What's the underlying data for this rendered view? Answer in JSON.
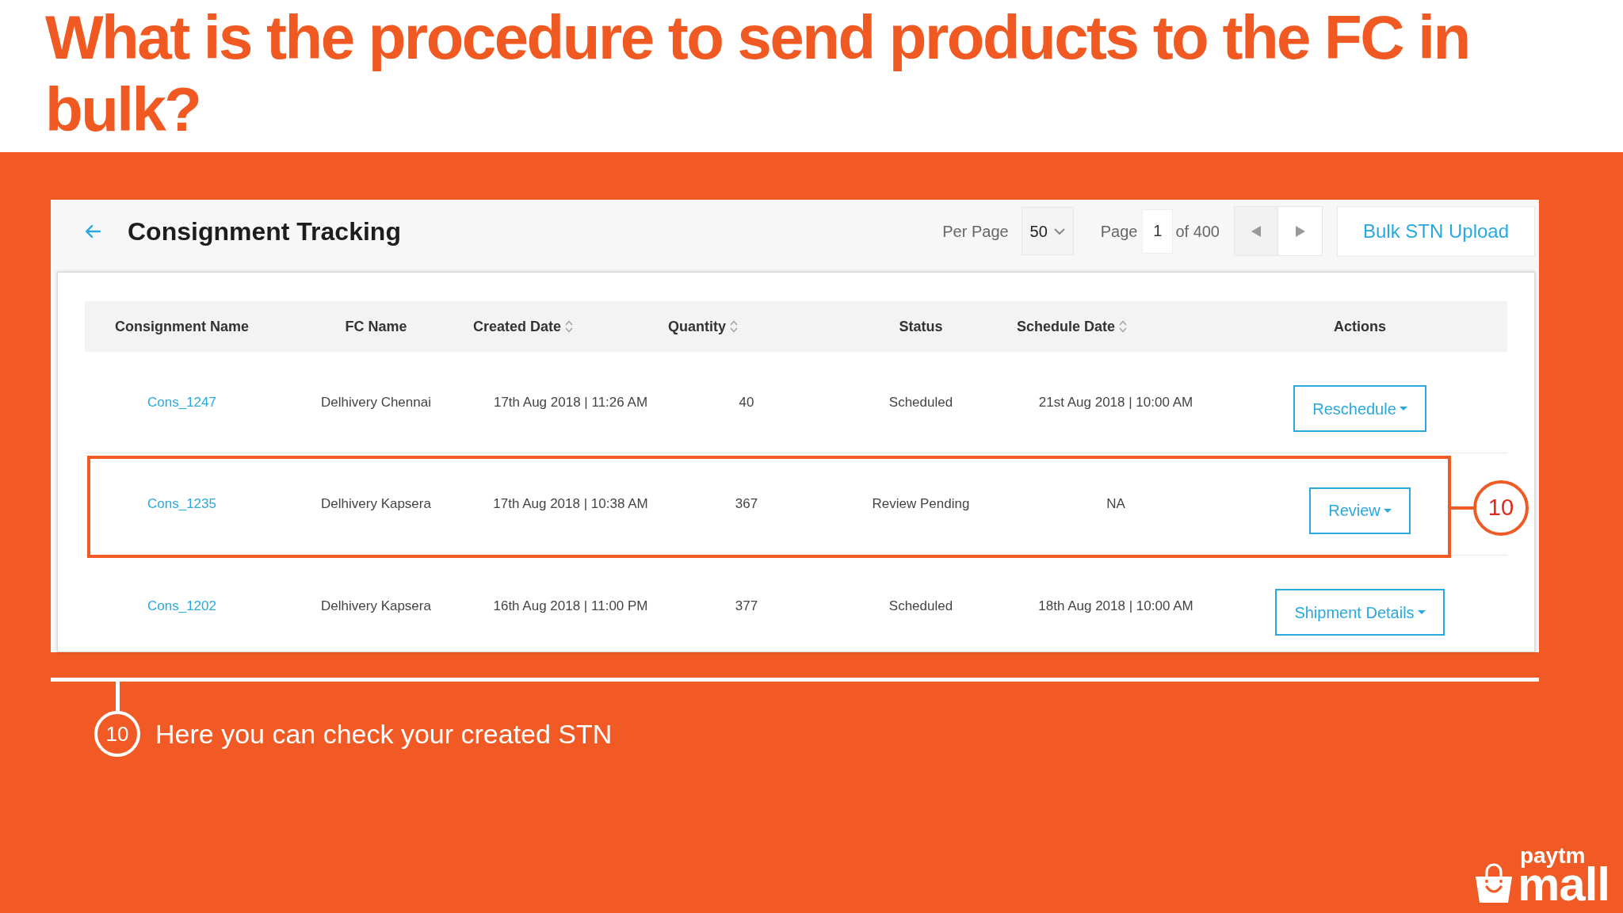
{
  "slide": {
    "title": "What is the procedure to send products to the FC in bulk?"
  },
  "panel": {
    "title": "Consignment Tracking",
    "pagination": {
      "per_page_label": "Per Page",
      "per_page": "50",
      "page_label": "Page",
      "page": "1",
      "page_total": "of 400",
      "prev": {
        "disabled": true
      },
      "next": {
        "disabled": false
      }
    },
    "upload_button": "Bulk STN Upload"
  },
  "table": {
    "columns": [
      {
        "label": "Consignment Name",
        "kind": "link",
        "sortable": false
      },
      {
        "label": "FC Name",
        "kind": "text",
        "sortable": false
      },
      {
        "label": "Created Date",
        "kind": "text",
        "sortable": true
      },
      {
        "label": "Quantity",
        "kind": "text",
        "sortable": true
      },
      {
        "label": "Status",
        "kind": "text",
        "sortable": false
      },
      {
        "label": "Schedule Date",
        "kind": "text",
        "sortable": true
      },
      {
        "label": "Actions",
        "kind": "action",
        "sortable": false
      }
    ],
    "rows": [
      {
        "highlighted": false,
        "cells": [
          "Cons_1247",
          "Delhivery Chennai",
          "17th Aug 2018 | 11:26 AM",
          "40",
          "Scheduled",
          "21st Aug 2018 | 10:00 AM",
          "Reschedule"
        ]
      },
      {
        "highlighted": true,
        "marker": "10",
        "cells": [
          "Cons_1235",
          "Delhivery Kapsera",
          "17th Aug 2018 | 10:38 AM",
          "367",
          "Review Pending",
          "NA",
          "Review"
        ]
      },
      {
        "highlighted": false,
        "cells": [
          "Cons_1202",
          "Delhivery Kapsera",
          "16th Aug 2018 | 11:00 PM",
          "377",
          "Scheduled",
          "18th Aug 2018 | 10:00 AM",
          "Shipment Details"
        ]
      }
    ]
  },
  "annotation": {
    "marker": "10",
    "text": "Here you can check your created STN"
  },
  "logo": {
    "line_1": "paytm",
    "line_2": "mall"
  }
}
